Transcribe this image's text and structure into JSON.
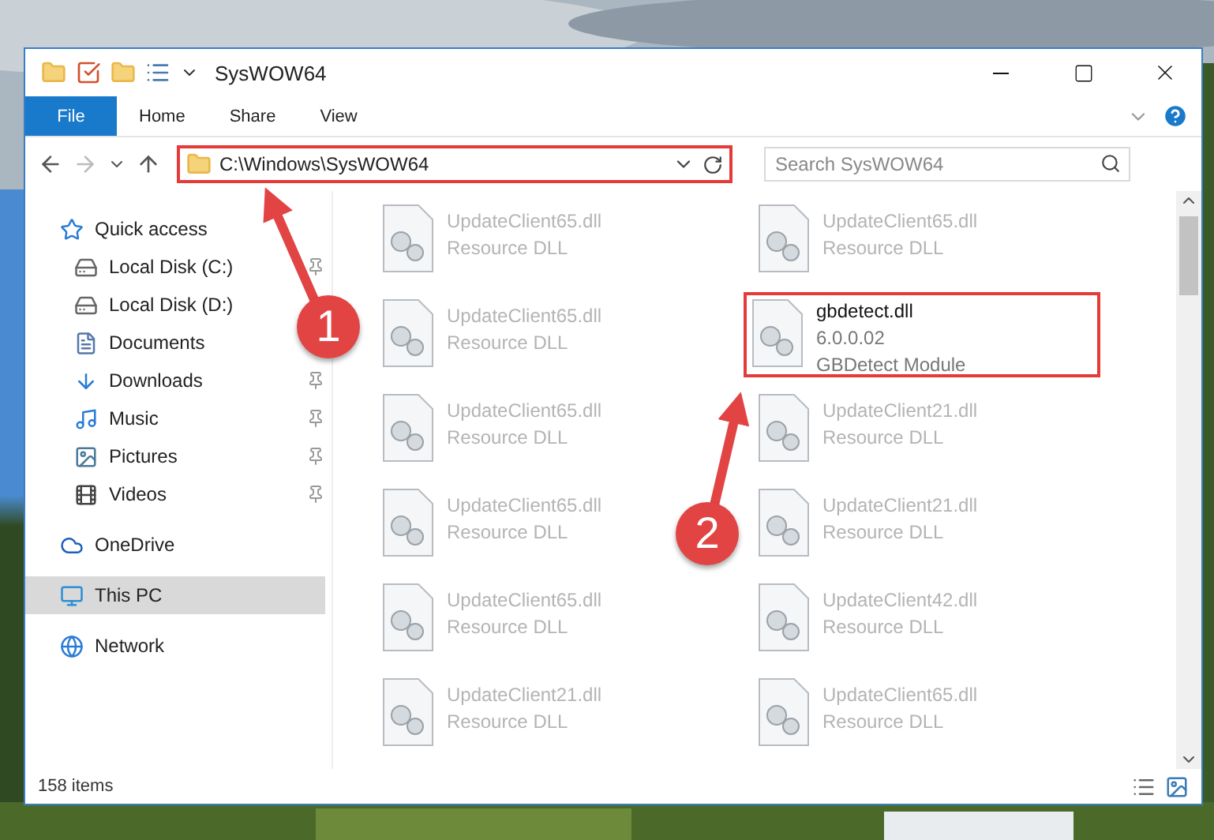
{
  "window": {
    "title": "SysWOW64"
  },
  "ribbon_tabs": [
    {
      "label": "File",
      "kind": "file"
    },
    {
      "label": "Home",
      "kind": "tab"
    },
    {
      "label": "Share",
      "kind": "tab"
    },
    {
      "label": "View",
      "kind": "tab"
    }
  ],
  "address": {
    "path": "C:\\Windows\\SysWOW64",
    "highlighted": true
  },
  "search": {
    "placeholder": "Search SysWOW64"
  },
  "sidebar": {
    "items": [
      {
        "label": "Quick access",
        "selected": false,
        "children": [
          {
            "label": "Local Disk (C:)",
            "pinned": true,
            "selected": false
          },
          {
            "label": "Local Disk (D:)",
            "pinned": false,
            "selected": false
          },
          {
            "label": "Documents",
            "pinned": false,
            "selected": false
          },
          {
            "label": "Downloads",
            "pinned": true,
            "selected": false
          },
          {
            "label": "Music",
            "pinned": true,
            "selected": false
          },
          {
            "label": "Pictures",
            "pinned": true,
            "selected": false
          },
          {
            "label": "Videos",
            "pinned": true,
            "selected": false
          }
        ]
      },
      {
        "label": "OneDrive",
        "selected": false
      },
      {
        "label": "This PC",
        "selected": true
      },
      {
        "label": "Network",
        "selected": false
      }
    ]
  },
  "files": [
    {
      "lines": [
        "UpdateClient65.dll",
        "Resource DLL"
      ],
      "highlighted": false
    },
    {
      "lines": [
        "UpdateClient65.dll",
        "Resource DLL"
      ],
      "highlighted": false
    },
    {
      "lines": [
        "UpdateClient65.dll",
        "Resource DLL"
      ],
      "highlighted": false
    },
    {
      "lines": [
        "gbdetect.dll",
        "6.0.0.02",
        "GBDetect Module"
      ],
      "highlighted": true
    },
    {
      "lines": [
        "UpdateClient65.dll",
        "Resource DLL"
      ],
      "highlighted": false
    },
    {
      "lines": [
        "UpdateClient21.dll",
        "Resource DLL"
      ],
      "highlighted": false
    },
    {
      "lines": [
        "UpdateClient65.dll",
        "Resource DLL"
      ],
      "highlighted": false
    },
    {
      "lines": [
        "UpdateClient21.dll",
        "Resource DLL"
      ],
      "highlighted": false
    },
    {
      "lines": [
        "UpdateClient65.dll",
        "Resource DLL"
      ],
      "highlighted": false
    },
    {
      "lines": [
        "UpdateClient42.dll",
        "Resource DLL"
      ],
      "highlighted": false
    },
    {
      "lines": [
        "UpdateClient21.dll",
        "Resource DLL"
      ],
      "highlighted": false
    },
    {
      "lines": [
        "UpdateClient65.dll",
        "Resource DLL"
      ],
      "highlighted": false
    }
  ],
  "status_bar": {
    "count": "158 items"
  },
  "annotations": [
    {
      "number": "1"
    },
    {
      "number": "2"
    }
  ]
}
